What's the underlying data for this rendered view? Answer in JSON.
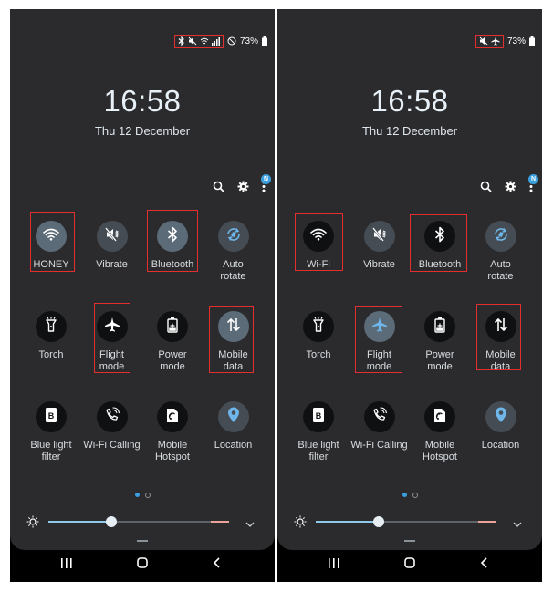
{
  "colors": {
    "accent": "#3aa0e0",
    "highlight": "#e23030",
    "panel": "#2b2b2d"
  },
  "left": {
    "status": {
      "battery": "73%"
    },
    "time": "16:58",
    "date": "Thu 12 December",
    "badge": "N",
    "tiles": [
      {
        "label": "HONEY",
        "icon": "wifi-icon",
        "state": "active"
      },
      {
        "label": "Vibrate",
        "icon": "vibrate-icon",
        "state": "gray"
      },
      {
        "label": "Bluetooth",
        "icon": "bluetooth-icon",
        "state": "active"
      },
      {
        "label": "Auto\nrotate",
        "icon": "auto-rotate-icon",
        "state": "gray"
      },
      {
        "label": "Torch",
        "icon": "torch-icon",
        "state": "black"
      },
      {
        "label": "Flight\nmode",
        "icon": "airplane-icon",
        "state": "black"
      },
      {
        "label": "Power\nmode",
        "icon": "power-mode-icon",
        "state": "black"
      },
      {
        "label": "Mobile\ndata",
        "icon": "mobile-data-icon",
        "state": "active"
      },
      {
        "label": "Blue light\nfilter",
        "icon": "blue-light-icon",
        "state": "black"
      },
      {
        "label": "Wi-Fi Calling",
        "icon": "wifi-calling-icon",
        "state": "black"
      },
      {
        "label": "Mobile\nHotspot",
        "icon": "hotspot-icon",
        "state": "black"
      },
      {
        "label": "Location",
        "icon": "location-icon",
        "state": "gray"
      }
    ],
    "brightness": 0.35
  },
  "right": {
    "status": {
      "battery": "73%"
    },
    "time": "16:58",
    "date": "Thu 12 December",
    "badge": "N",
    "tiles": [
      {
        "label": "Wi-Fi",
        "icon": "wifi-icon",
        "state": "black"
      },
      {
        "label": "Vibrate",
        "icon": "vibrate-icon",
        "state": "gray"
      },
      {
        "label": "Bluetooth",
        "icon": "bluetooth-icon",
        "state": "black"
      },
      {
        "label": "Auto\nrotate",
        "icon": "auto-rotate-icon",
        "state": "gray"
      },
      {
        "label": "Torch",
        "icon": "torch-icon",
        "state": "black"
      },
      {
        "label": "Flight\nmode",
        "icon": "airplane-icon",
        "state": "active"
      },
      {
        "label": "Power\nmode",
        "icon": "power-mode-icon",
        "state": "black"
      },
      {
        "label": "Mobile\ndata",
        "icon": "mobile-data-icon",
        "state": "black"
      },
      {
        "label": "Blue light\nfilter",
        "icon": "blue-light-icon",
        "state": "black"
      },
      {
        "label": "Wi-Fi Calling",
        "icon": "wifi-calling-icon",
        "state": "black"
      },
      {
        "label": "Mobile\nHotspot",
        "icon": "hotspot-icon",
        "state": "black"
      },
      {
        "label": "Location",
        "icon": "location-icon",
        "state": "gray"
      }
    ],
    "brightness": 0.35
  }
}
